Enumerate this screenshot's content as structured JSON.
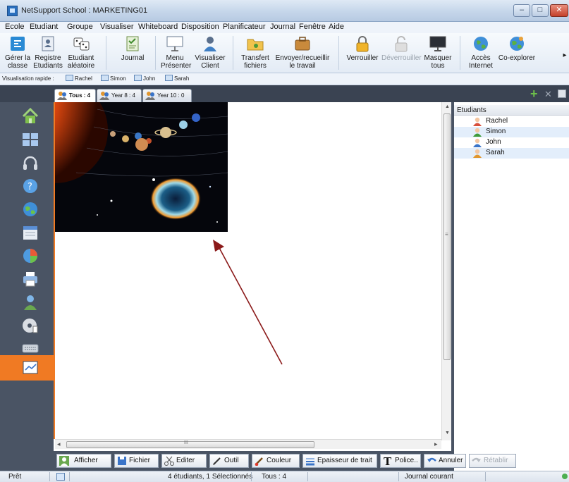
{
  "window": {
    "title": "NetSupport School : MARKETING01",
    "min": "–",
    "max": "□",
    "close": "✕"
  },
  "menu": [
    "Ecole",
    "Etudiant",
    "Groupe",
    "Visualiser",
    "Whiteboard",
    "Disposition",
    "Planificateur",
    "Journal",
    "Fenêtre",
    "Aide"
  ],
  "toolbar": {
    "manage": [
      "Gérer la",
      "classe"
    ],
    "register": [
      "Registre",
      "Etudiants"
    ],
    "random": [
      "Etudiant",
      "aléatoire"
    ],
    "journal": [
      "Journal"
    ],
    "menu_presenter": [
      "Menu",
      "Présenter"
    ],
    "view_client": [
      "Visualiser",
      "Client"
    ],
    "file_transfer": [
      "Transfert",
      "fichiers"
    ],
    "send_collect": [
      "Envoyer/recueillir",
      "le travail"
    ],
    "lock": [
      "Verrouiller"
    ],
    "unlock": [
      "Déverrouiller"
    ],
    "hide_all": [
      "Masquer",
      "tous"
    ],
    "internet": [
      "Accès",
      "Internet"
    ],
    "co_explore": [
      "Co-explorer"
    ],
    "more": "▸"
  },
  "quickview": {
    "label": "Visualisation rapide :",
    "students": [
      "Rachel",
      "Simon",
      "John",
      "Sarah"
    ]
  },
  "tabs": [
    "Tous : 4",
    "Year 8 : 4",
    "Year 10 : 0"
  ],
  "tab_actions": {
    "add": "+",
    "remove": "✕"
  },
  "panel": {
    "header": "Etudiants",
    "students": [
      {
        "name": "Rachel",
        "color": "#d8503c"
      },
      {
        "name": "Simon",
        "color": "#3f9b3a"
      },
      {
        "name": "John",
        "color": "#3a74c8"
      },
      {
        "name": "Sarah",
        "color": "#e0962f"
      }
    ]
  },
  "scroll": {
    "up": "▲",
    "down": "▼",
    "left": "◂",
    "right": "▸",
    "grip_v": "≡",
    "grip_h": "III"
  },
  "bottom_toolbar": {
    "show": "Afficher",
    "file": "Fichier ▲",
    "edit": "Editer ▲",
    "tool": "Outil ▲",
    "color": "Couleur ▲",
    "thickness": "Epaisseur de trait ▲",
    "font": "Police..",
    "undo": "Annuler",
    "redo": "Rétablir"
  },
  "status": {
    "ready": "Prêt",
    "students": "4 étudiants, 1 Sélectionnés",
    "group": "Tous : 4",
    "journal": "Journal courant"
  },
  "colors": {
    "accent": "#f07a23",
    "sidebar": "#4a5464",
    "arrow": "#8b1a1a"
  }
}
